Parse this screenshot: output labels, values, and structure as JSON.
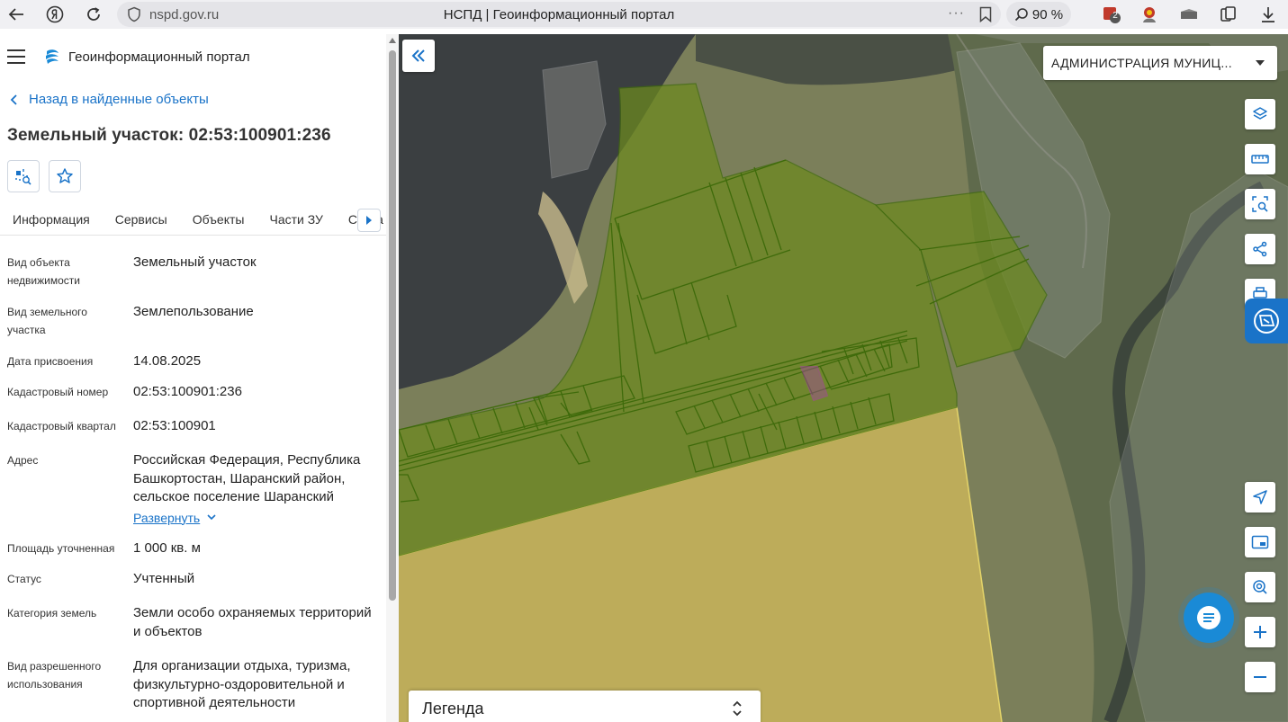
{
  "browser": {
    "url": "nspd.gov.ru",
    "tab_title": "НСПД | Геоинформационный портал",
    "zoom": "90 %",
    "ext_badge": "2"
  },
  "sidebar": {
    "portal_name": "Геоинформационный портал",
    "back_label": "Назад в найденные объекты",
    "title": "Земельный участок: 02:53:100901:236",
    "tabs": [
      {
        "label": "Информация"
      },
      {
        "label": "Сервисы"
      },
      {
        "label": "Объекты"
      },
      {
        "label": "Части ЗУ"
      },
      {
        "label": "Соста"
      }
    ],
    "properties": [
      {
        "label": "Вид объекта недвижимости",
        "value": "Земельный участок"
      },
      {
        "label": "Вид земельного участка",
        "value": "Землепользование"
      },
      {
        "label": "Дата присвоения",
        "value": "14.08.2025"
      },
      {
        "label": "Кадастровый номер",
        "value": "02:53:100901:236"
      },
      {
        "label": "Кадастровый квартал",
        "value": "02:53:100901"
      },
      {
        "label": "Адрес",
        "value": "Российская Федерация, Республика Башкортостан, Шаранский район, сельское поселение Шаранский",
        "expand": "Развернуть"
      },
      {
        "label": "Площадь уточненная",
        "value": "1 000 кв. м"
      },
      {
        "label": "Статус",
        "value": "Учтенный"
      },
      {
        "label": "Категория земель",
        "value": "Земли особо охраняемых территорий и объектов"
      },
      {
        "label": "Вид разрешенного использования",
        "value": "Для организации отдыха, туризма, физкультурно-оздоровительной и спортивной деятельности"
      }
    ]
  },
  "map": {
    "layer_select": "АДМИНИСТРАЦИЯ МУНИЦ...",
    "legend_label": "Легенда",
    "colors": {
      "parcel_fill": "#6c8a1e",
      "parcel_stroke": "#3f6b0b",
      "yellow_zone": "#c9b45a",
      "selected": "#b03ab5",
      "accent": "#1a73c8"
    }
  }
}
